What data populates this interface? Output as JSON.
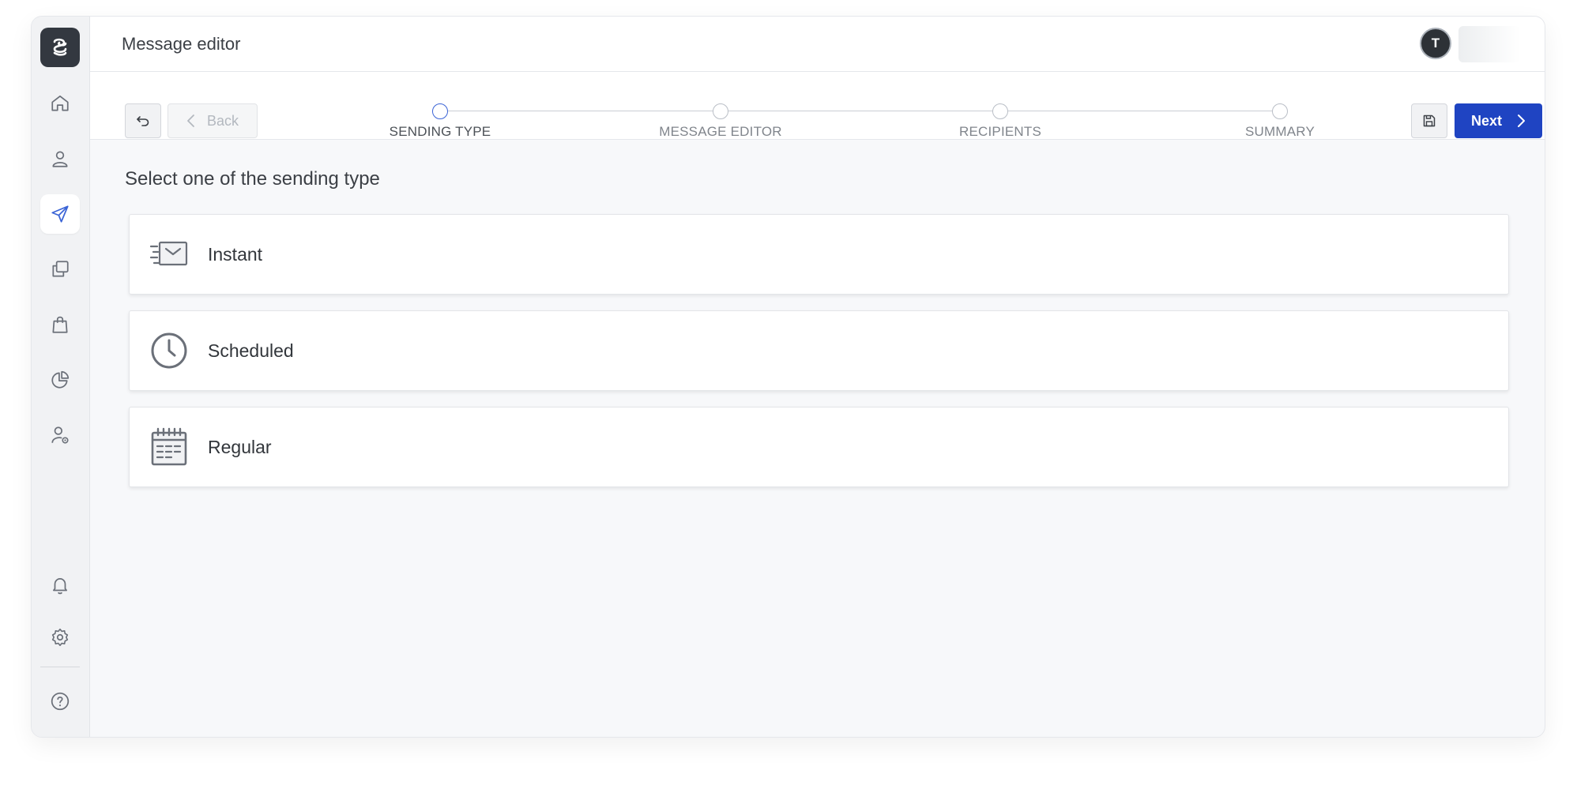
{
  "app": {
    "page_title": "Message editor",
    "user_initial": "T"
  },
  "sidebar": {
    "items": [
      {
        "name": "home",
        "icon": "home-icon",
        "active": false
      },
      {
        "name": "contacts",
        "icon": "user-icon",
        "active": false
      },
      {
        "name": "campaigns",
        "icon": "send-icon",
        "active": true
      },
      {
        "name": "templates",
        "icon": "copy-icon",
        "active": false
      },
      {
        "name": "shop",
        "icon": "shopping-bag-icon",
        "active": false
      },
      {
        "name": "reports",
        "icon": "pie-chart-icon",
        "active": false
      },
      {
        "name": "user-settings",
        "icon": "user-gear-icon",
        "active": false
      }
    ],
    "bottom_items": [
      {
        "name": "notifications",
        "icon": "bell-icon"
      },
      {
        "name": "settings",
        "icon": "gear-icon"
      },
      {
        "name": "help",
        "icon": "question-icon"
      }
    ]
  },
  "toolbar": {
    "back_label": "Back",
    "next_label": "Next"
  },
  "steps": [
    {
      "label": "SENDING TYPE",
      "active": true
    },
    {
      "label": "MESSAGE EDITOR",
      "active": false
    },
    {
      "label": "RECIPIENTS",
      "active": false
    },
    {
      "label": "SUMMARY",
      "active": false
    }
  ],
  "main": {
    "section_title": "Select one of the sending type",
    "options": [
      {
        "label": "Instant",
        "icon": "envelope-fast-icon"
      },
      {
        "label": "Scheduled",
        "icon": "clock-icon"
      },
      {
        "label": "Regular",
        "icon": "calendar-icon"
      }
    ]
  },
  "colors": {
    "accent": "#1f44c2",
    "active_nav": "#3b64d6",
    "icon": "#6b7079"
  }
}
